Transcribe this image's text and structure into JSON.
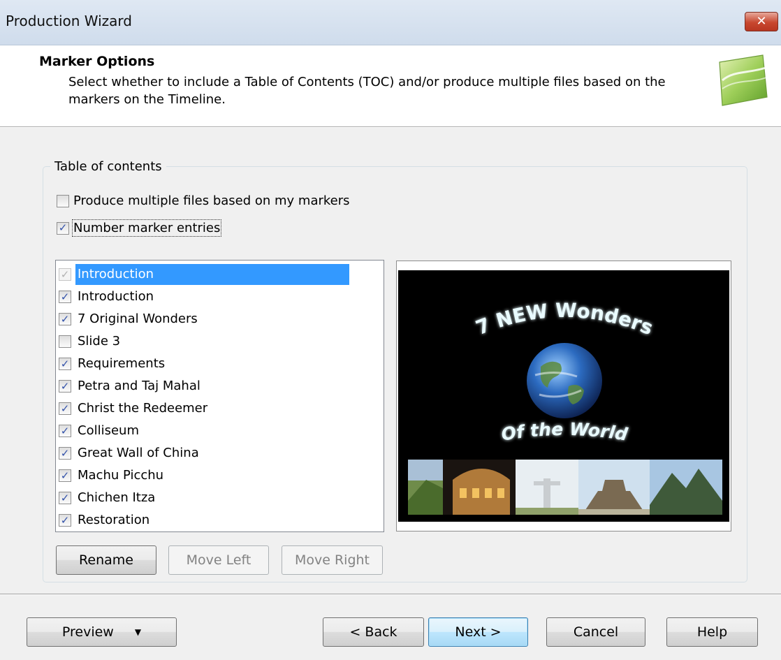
{
  "window": {
    "title": "Production Wizard"
  },
  "header": {
    "title": "Marker Options",
    "description": "Select whether to include a Table of Contents (TOC) and/or produce multiple files based on the markers on the Timeline."
  },
  "toc_group": {
    "label": "Table of contents",
    "produce_multiple_files": {
      "label": "Produce multiple files based on my markers",
      "checked": false
    },
    "number_marker_entries": {
      "label": "Number marker entries",
      "checked": true
    }
  },
  "markers": [
    {
      "label": "Introduction",
      "checked": true,
      "selected": true,
      "disabled": true
    },
    {
      "label": "Introduction",
      "checked": true
    },
    {
      "label": "7 Original Wonders",
      "checked": true
    },
    {
      "label": "Slide 3",
      "checked": false
    },
    {
      "label": "Requirements",
      "checked": true
    },
    {
      "label": "Petra and Taj Mahal",
      "checked": true
    },
    {
      "label": "Christ the Redeemer",
      "checked": true
    },
    {
      "label": "Colliseum",
      "checked": true
    },
    {
      "label": "Great Wall of China",
      "checked": true
    },
    {
      "label": "Machu Picchu",
      "checked": true
    },
    {
      "label": "Chichen Itza",
      "checked": true
    },
    {
      "label": "Restoration",
      "checked": true
    }
  ],
  "preview_image": {
    "title_text": "7 NEW Wonders",
    "subtitle_text": "Of the World"
  },
  "list_buttons": {
    "rename": "Rename",
    "move_left": "Move Left",
    "move_right": "Move Right"
  },
  "footer": {
    "preview": "Preview",
    "back": "< Back",
    "next": "Next >",
    "cancel": "Cancel",
    "help": "Help"
  },
  "colors": {
    "selection": "#3399ff",
    "check": "#3352a9",
    "glow_text": "#d7f3ff",
    "close_button": "#c8472f"
  }
}
